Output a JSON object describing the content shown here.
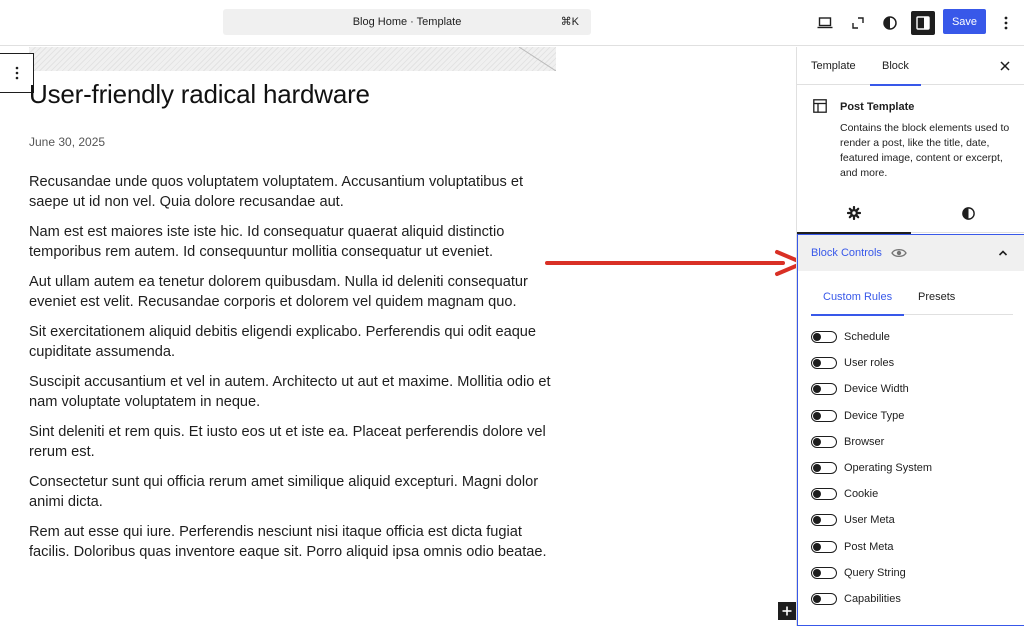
{
  "header": {
    "document_title": "Blog Home · Template",
    "shortcut": "⌘K",
    "save_label": "Save",
    "icons": [
      "desktop-view-icon",
      "external-link-icon",
      "contrast-icon",
      "sidebar-toggle-icon",
      "more-vertical-icon"
    ]
  },
  "canvas": {
    "post_title": "User-friendly radical hardware",
    "post_date": "June 30, 2025",
    "paragraphs": [
      "Recusandae unde quos voluptatem voluptatem. Accusantium voluptatibus et saepe ut id non vel. Quia dolore recusandae aut.",
      "Nam est est maiores iste iste hic. Id consequatur quaerat aliquid distinctio temporibus rem autem. Id consequuntur mollitia consequatur ut eveniet.",
      "Aut ullam autem ea tenetur dolorem quibusdam. Nulla id deleniti consequatur eveniet est velit. Recusandae corporis et dolorem vel quidem magnam quo.",
      "Sit exercitationem aliquid debitis eligendi explicabo. Perferendis qui odit eaque cupiditate assumenda.",
      "Suscipit accusantium et vel in autem. Architecto ut aut et maxime. Mollitia odio et nam voluptate voluptatem in neque.",
      "Sint deleniti et rem quis. Et iusto eos ut et iste ea. Placeat perferendis dolore vel rerum est.",
      "Consectetur sunt qui officia rerum amet similique aliquid excepturi. Magni dolor animi dicta.",
      "Rem aut esse qui iure. Perferendis nesciunt nisi itaque officia est dicta fugiat facilis. Doloribus quas inventore eaque sit. Porro aliquid ipsa omnis odio beatae."
    ]
  },
  "sidebar": {
    "tabs": [
      "Template",
      "Block"
    ],
    "active_tab": "Block",
    "block": {
      "name": "Post Template",
      "description": "Contains the block elements used to render a post, like the title, date, featured image, content or excerpt, and more."
    },
    "sub_tabs": [
      "settings-gear-icon",
      "styles-contrast-icon"
    ],
    "block_controls": {
      "label": "Block Controls",
      "expanded": true,
      "tabs": [
        "Custom Rules",
        "Presets"
      ],
      "active_tab": "Custom Rules",
      "rules": [
        {
          "label": "Schedule",
          "enabled": false
        },
        {
          "label": "User roles",
          "enabled": false
        },
        {
          "label": "Device Width",
          "enabled": false
        },
        {
          "label": "Device Type",
          "enabled": false
        },
        {
          "label": "Browser",
          "enabled": false
        },
        {
          "label": "Operating System",
          "enabled": false
        },
        {
          "label": "Cookie",
          "enabled": false
        },
        {
          "label": "User Meta",
          "enabled": false
        },
        {
          "label": "Post Meta",
          "enabled": false
        },
        {
          "label": "Query String",
          "enabled": false
        },
        {
          "label": "Capabilities",
          "enabled": false
        }
      ]
    }
  },
  "colors": {
    "accent": "#3858e9",
    "annotation_arrow": "#d93025",
    "text": "#1e1e1e"
  }
}
